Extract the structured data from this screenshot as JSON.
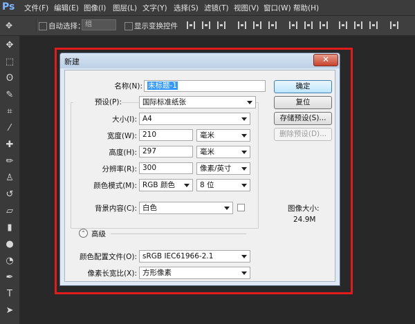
{
  "app": {
    "logo": "Ps"
  },
  "menu": [
    "文件(F)",
    "编辑(E)",
    "图像(I)",
    "图层(L)",
    "文字(Y)",
    "选择(S)",
    "滤镜(T)",
    "视图(V)",
    "窗口(W)",
    "帮助(H)"
  ],
  "options": {
    "auto_select_label": "自动选择：",
    "auto_select_value": "组",
    "show_transform_label": "显示变换控件"
  },
  "dialog": {
    "title": "新建",
    "close_glyph": "✕",
    "name_label": "名称(N):",
    "name_value": "未标题-1",
    "preset_label": "预设(P):",
    "preset_value": "国际标准纸张",
    "size_label": "大小(I):",
    "size_value": "A4",
    "width_label": "宽度(W):",
    "width_value": "210",
    "width_unit": "毫米",
    "height_label": "高度(H):",
    "height_value": "297",
    "height_unit": "毫米",
    "resolution_label": "分辨率(R):",
    "resolution_value": "300",
    "resolution_unit": "像素/英寸",
    "color_mode_label": "颜色模式(M):",
    "color_mode_value": "RGB 颜色",
    "bit_depth_value": "8 位",
    "background_label": "背景内容(C):",
    "background_value": "白色",
    "advanced_label": "高级",
    "advanced_glyph": "⌃",
    "color_profile_label": "颜色配置文件(O):",
    "color_profile_value": "sRGB IEC61966-2.1",
    "pixel_aspect_label": "像素长宽比(X):",
    "pixel_aspect_value": "方形像素",
    "buttons": {
      "ok": "确定",
      "reset": "复位",
      "save_preset": "存储预设(S)...",
      "delete_preset": "删除预设(D)..."
    },
    "image_size_label": "图像大小:",
    "image_size_value": "24.9M"
  }
}
